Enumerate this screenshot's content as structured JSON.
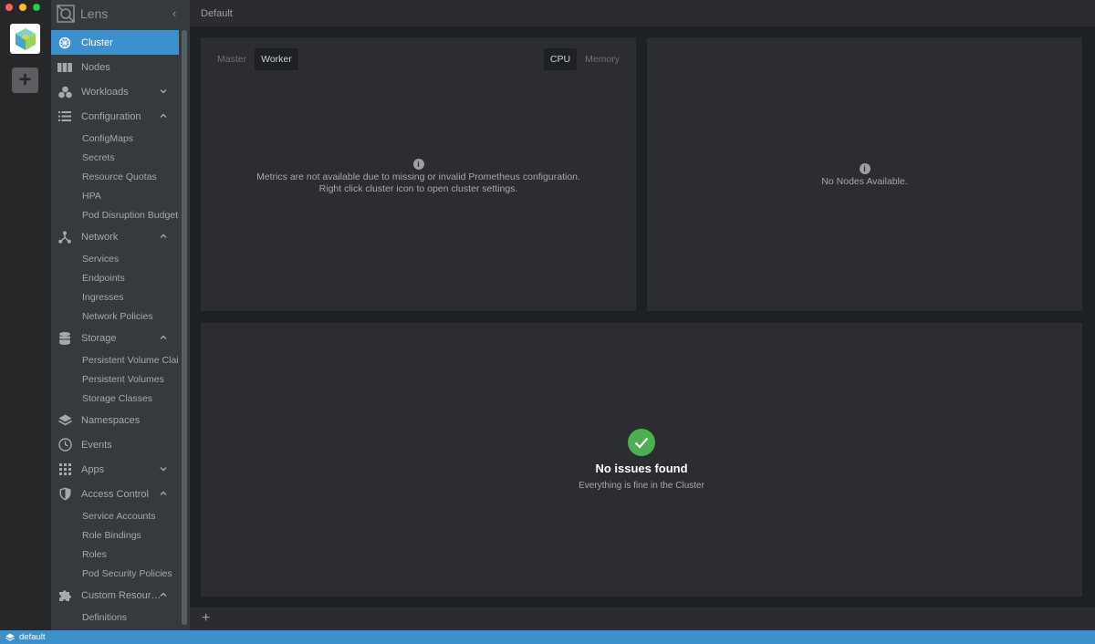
{
  "window": {
    "traffic_colors": [
      "#ff5f57",
      "#febc2e",
      "#28c840"
    ]
  },
  "sidebar": {
    "title": "Lens",
    "items": [
      {
        "label": "Cluster",
        "icon": "cluster-icon",
        "active": true
      },
      {
        "label": "Nodes",
        "icon": "nodes-icon"
      },
      {
        "label": "Workloads",
        "icon": "workloads-icon",
        "chevron": "down"
      },
      {
        "label": "Configuration",
        "icon": "list-icon",
        "chevron": "up"
      },
      {
        "label": "Network",
        "icon": "network-icon",
        "chevron": "up"
      },
      {
        "label": "Storage",
        "icon": "database-icon",
        "chevron": "up"
      },
      {
        "label": "Namespaces",
        "icon": "layers-icon"
      },
      {
        "label": "Events",
        "icon": "clock-icon"
      },
      {
        "label": "Apps",
        "icon": "grid-icon",
        "chevron": "down"
      },
      {
        "label": "Access Control",
        "icon": "shield-icon",
        "chevron": "up"
      },
      {
        "label": "Custom Resources",
        "icon": "puzzle-icon",
        "chevron": "up"
      }
    ],
    "configuration_sub": [
      "ConfigMaps",
      "Secrets",
      "Resource Quotas",
      "HPA",
      "Pod Disruption Budgets"
    ],
    "network_sub": [
      "Services",
      "Endpoints",
      "Ingresses",
      "Network Policies"
    ],
    "storage_sub": [
      "Persistent Volume Claims",
      "Persistent Volumes",
      "Storage Classes"
    ],
    "access_sub": [
      "Service Accounts",
      "Role Bindings",
      "Roles",
      "Pod Security Policies"
    ],
    "custom_sub": [
      "Definitions"
    ]
  },
  "header": {
    "title": "Default"
  },
  "metrics_panel": {
    "tabs_left": [
      {
        "label": "Master"
      },
      {
        "label": "Worker",
        "active": true
      }
    ],
    "tabs_right": [
      {
        "label": "CPU",
        "active": true
      },
      {
        "label": "Memory"
      }
    ],
    "message_line1": "Metrics are not available due to missing or invalid Prometheus configuration.",
    "message_line2": "Right click cluster icon to open cluster settings."
  },
  "nodes_panel": {
    "message": "No Nodes Available."
  },
  "issues_panel": {
    "title": "No issues found",
    "subtitle": "Everything is fine in the Cluster"
  },
  "status": {
    "context": "default"
  },
  "colors": {
    "accent": "#3d90ce",
    "success": "#4caf50"
  }
}
